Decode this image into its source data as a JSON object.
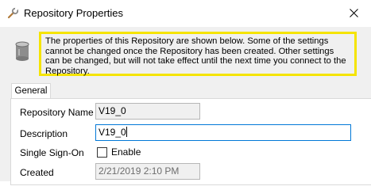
{
  "window": {
    "title": "Repository Properties"
  },
  "info": {
    "message": "The properties of this Repository are shown below. Some of the settings cannot be changed once the Repository has been created. Other settings can be changed, but will not take effect until the next time you connect to the Repository."
  },
  "tabs": [
    {
      "label": "General",
      "selected": true
    }
  ],
  "form": {
    "repository_name": {
      "label": "Repository Name",
      "value": "V19_0"
    },
    "description": {
      "label": "Description",
      "value": "V19_0"
    },
    "single_sign_on": {
      "label": "Single Sign-On",
      "checkbox_label": "Enable",
      "checked": false
    },
    "created": {
      "label": "Created",
      "value": "2/21/2019 2:10 PM"
    }
  },
  "colors": {
    "highlight_border": "#f5e400",
    "focus_border": "#0078d7"
  },
  "icons": {
    "app": "wrench-icon",
    "close": "close-icon",
    "info": "database-icon"
  }
}
